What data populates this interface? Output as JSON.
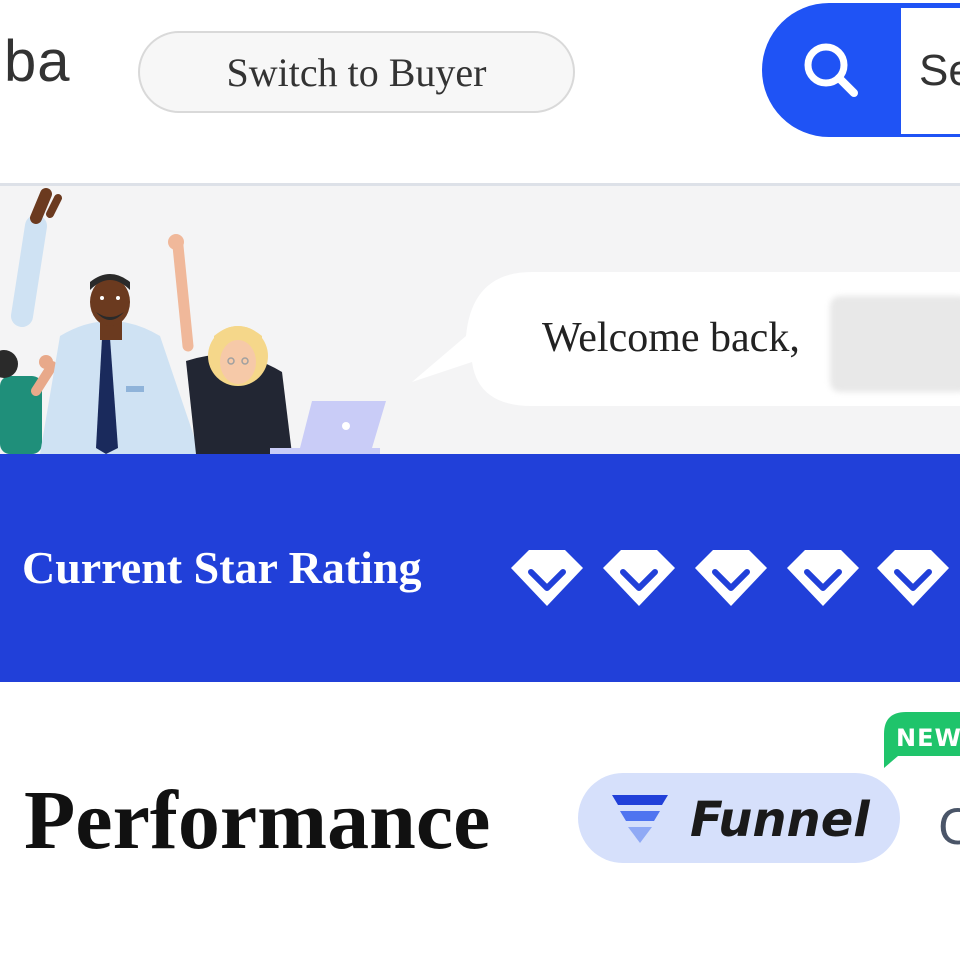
{
  "header": {
    "logo_text": "ba",
    "switch_button_label": "Switch to Buyer",
    "search_placeholder": "Se",
    "accent_color": "#1f53f5"
  },
  "hero": {
    "welcome_text": "Welcome back,"
  },
  "rating": {
    "label": "Current Star Rating",
    "diamonds": [
      "diamond-icon",
      "diamond-icon",
      "diamond-icon",
      "diamond-icon",
      "diamond-icon"
    ],
    "band_color": "#2140d9"
  },
  "performance": {
    "title": "Performance",
    "funnel_label": "Funnel",
    "new_badge": "NEW",
    "trailing_text": "C",
    "badge_color": "#1fc46b"
  }
}
